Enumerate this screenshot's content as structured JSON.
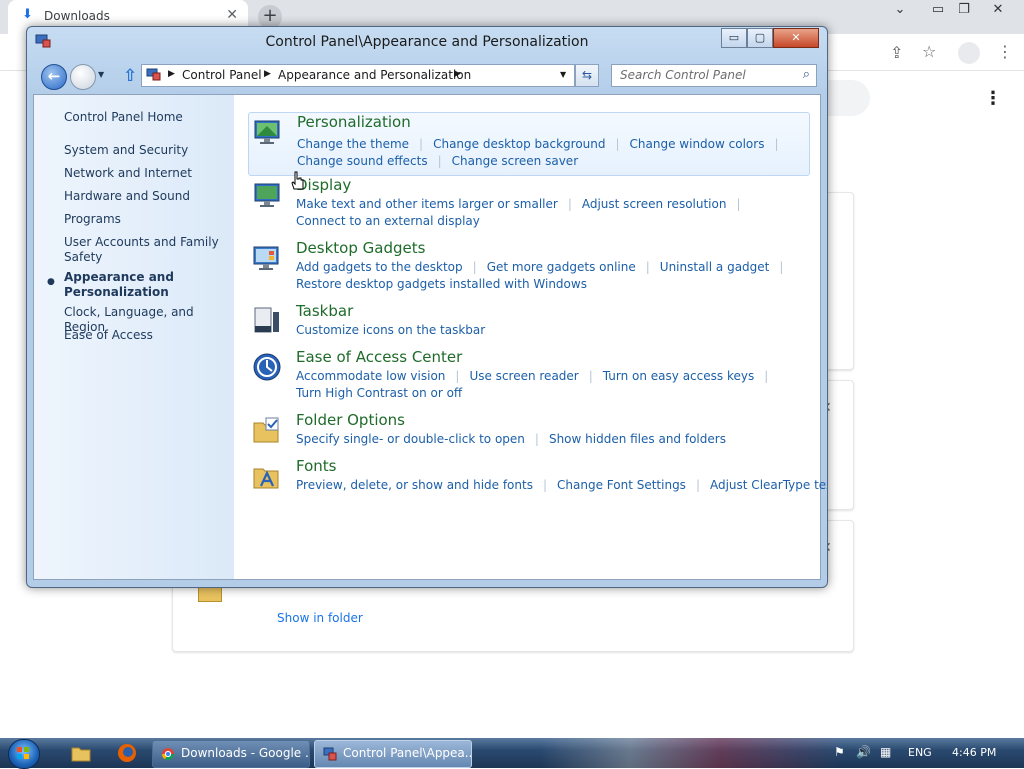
{
  "browser": {
    "tab_title": "Downloads",
    "show_in_folder": "Show in folder"
  },
  "window": {
    "title": "Control Panel\\Appearance and Personalization",
    "caption_minimize": "▭",
    "caption_maximize": "▢",
    "caption_close": "✕"
  },
  "address": {
    "crumbs": [
      "Control Panel",
      "Appearance and Personalization"
    ],
    "search_placeholder": "Search Control Panel"
  },
  "sidebar": {
    "home": "Control Panel Home",
    "items": [
      "System and Security",
      "Network and Internet",
      "Hardware and Sound",
      "Programs",
      "User Accounts and Family Safety",
      "Appearance and Personalization",
      "Clock, Language, and Region",
      "Ease of Access"
    ]
  },
  "categories": [
    {
      "title": "Personalization",
      "rows": [
        [
          "Change the theme",
          "Change desktop background",
          "Change window colors"
        ],
        [
          "Change sound effects",
          "Change screen saver"
        ]
      ]
    },
    {
      "title": "Display",
      "rows": [
        [
          "Make text and other items larger or smaller",
          "Adjust screen resolution"
        ],
        [
          "Connect to an external display"
        ]
      ]
    },
    {
      "title": "Desktop Gadgets",
      "rows": [
        [
          "Add gadgets to the desktop",
          "Get more gadgets online",
          "Uninstall a gadget"
        ],
        [
          "Restore desktop gadgets installed with Windows"
        ]
      ]
    },
    {
      "title": "Taskbar",
      "rows": [
        [
          "Customize icons on the taskbar"
        ]
      ]
    },
    {
      "title": "Ease of Access Center",
      "rows": [
        [
          "Accommodate low vision",
          "Use screen reader",
          "Turn on easy access keys"
        ],
        [
          "Turn High Contrast on or off"
        ]
      ]
    },
    {
      "title": "Folder Options",
      "rows": [
        [
          "Specify single- or double-click to open",
          "Show hidden files and folders"
        ]
      ]
    },
    {
      "title": "Fonts",
      "rows": [
        [
          "Preview, delete, or show and hide fonts",
          "Change Font Settings",
          "Adjust ClearType text"
        ]
      ]
    }
  ],
  "taskbar": {
    "buttons": [
      "Downloads - Google ...",
      "Control Panel\\Appea..."
    ],
    "language": "ENG",
    "time": "4:46 PM"
  },
  "colors": {
    "category_title": "#1f6b2a",
    "link": "#1c5fa8",
    "sidebar_text": "#1e395b"
  }
}
